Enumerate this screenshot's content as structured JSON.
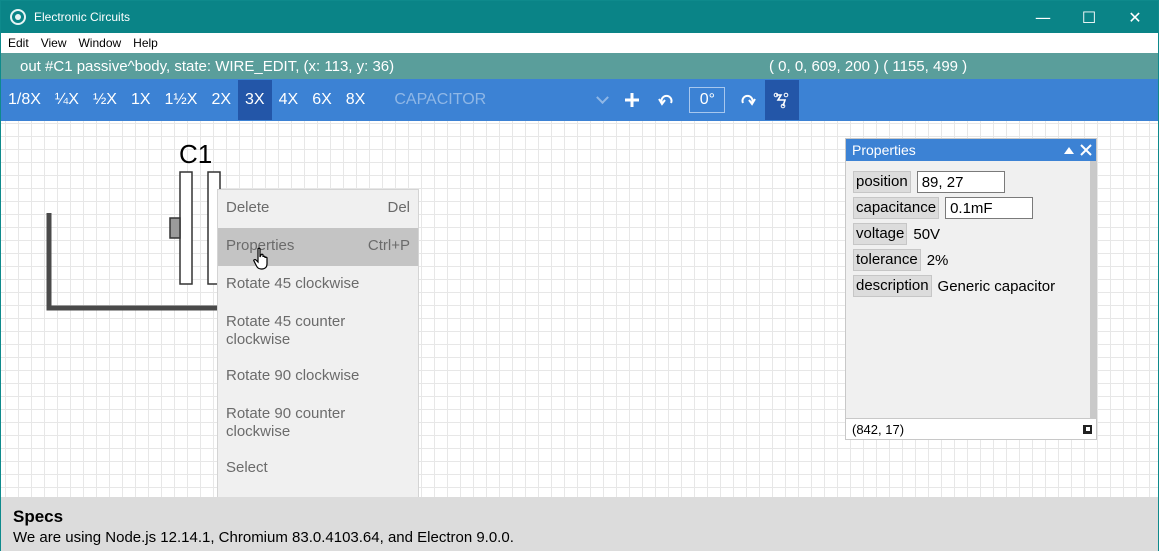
{
  "window": {
    "title": "Electronic Circuits",
    "minimize": "—",
    "maximize": "☐",
    "close": "✕"
  },
  "menu": [
    "Edit",
    "View",
    "Window",
    "Help"
  ],
  "status": {
    "text": "out #C1 passive^body, state: WIRE_EDIT, (x: 113, y: 36)",
    "coords": "( 0, 0, 609, 200 )  ( 1155, 499 )"
  },
  "toolbar": {
    "zooms": [
      "1/8X",
      "¼X",
      "½X",
      "1X",
      "1½X",
      "2X",
      "3X",
      "4X",
      "6X",
      "8X"
    ],
    "active_zoom": "3X",
    "component": "CAPACITOR",
    "angle": "0°"
  },
  "canvas": {
    "component_label": "C1"
  },
  "context_menu": {
    "items": [
      {
        "label": "Delete",
        "shortcut": "Del"
      },
      {
        "label": "Properties",
        "shortcut": "Ctrl+P"
      },
      {
        "label": "Rotate 45 clockwise",
        "shortcut": ""
      },
      {
        "label": "Rotate 45 counter clockwise",
        "shortcut": ""
      },
      {
        "label": "Rotate 90 clockwise",
        "shortcut": ""
      },
      {
        "label": "Rotate 90 counter clockwise",
        "shortcut": ""
      },
      {
        "label": "Select",
        "shortcut": ""
      }
    ],
    "hovered": "Properties"
  },
  "properties": {
    "title": "Properties",
    "position_label": "position",
    "position_value": "89, 27",
    "capacitance_label": "capacitance",
    "capacitance_value": "0.1mF",
    "voltage_label": "voltage",
    "voltage_value": "50V",
    "tolerance_label": "tolerance",
    "tolerance_value": "2%",
    "description_label": "description",
    "description_value": "Generic capacitor",
    "footer": "(842, 17)"
  },
  "specs": {
    "title": "Specs",
    "text": "We are using Node.js 12.14.1, Chromium 83.0.4103.64, and Electron 9.0.0."
  },
  "colors": {
    "titlebar": "#0a8487",
    "statusbar": "#5a9e9b",
    "toolbar": "#3c82d4",
    "active": "#2356a8"
  }
}
